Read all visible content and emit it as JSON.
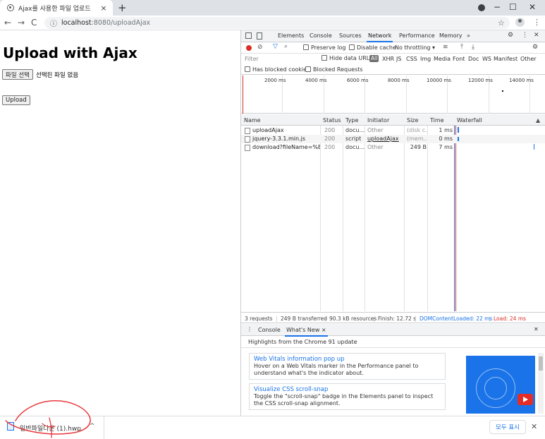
{
  "browser": {
    "tab_title": "Ajax를 사용한 파일 업로드",
    "url_host": "localhost",
    "url_rest": ":8080/uploadAjax"
  },
  "page": {
    "heading": "Upload with Ajax",
    "file_button": "파일 선택",
    "file_status": "선택된 파일 없음",
    "upload_button": "Upload"
  },
  "devtools": {
    "tabs": [
      "Elements",
      "Console",
      "Sources",
      "Network",
      "Performance",
      "Memory"
    ],
    "more_tabs": "»",
    "toolbar": {
      "preserve_log": "Preserve log",
      "disable_cache": "Disable cache",
      "throttling": "No throttling ▾"
    },
    "filter_placeholder": "Filter",
    "hide_data_urls": "Hide data URLs",
    "types": [
      "All",
      "XHR",
      "JS",
      "CSS",
      "Img",
      "Media",
      "Font",
      "Doc",
      "WS",
      "Manifest",
      "Other"
    ],
    "blocked_cookies": "Has blocked cookies",
    "blocked_requests": "Blocked Requests",
    "ticks": [
      "2000 ms",
      "4000 ms",
      "6000 ms",
      "8000 ms",
      "10000 ms",
      "12000 ms",
      "14000 ms"
    ],
    "columns": [
      "Name",
      "Status",
      "Type",
      "Initiator",
      "Size",
      "Time",
      "Waterfall"
    ],
    "requests": [
      {
        "name": "uploadAjax",
        "status": "200",
        "type": "docu...",
        "initiator": "Other",
        "size": "(disk c...",
        "time": "1 ms"
      },
      {
        "name": "jquery-3.3.1.min.js",
        "status": "200",
        "type": "script",
        "initiator": "uploadAjax",
        "size": "(mem...",
        "time": "0 ms"
      },
      {
        "name": "download?fileName=%EC...",
        "status": "200",
        "type": "docu...",
        "initiator": "Other",
        "size": "249 B",
        "time": "7 ms"
      }
    ],
    "summary": {
      "requests": "3 requests",
      "transferred": "249 B transferred",
      "resources": "90.3 kB resources",
      "finish": "Finish: 12.72 s",
      "dom": "DOMContentLoaded: 22 ms",
      "load": "Load: 24 ms"
    },
    "drawer": {
      "console": "Console",
      "whatsnew": "What's New ×",
      "highlights": "Highlights from the Chrome 91 update",
      "items": [
        {
          "title": "Web Vitals information pop up",
          "desc": "Hover on a Web Vitals marker in the Performance panel to understand what's the indicator about."
        },
        {
          "title": "Visualize CSS scroll-snap",
          "desc": "Toggle the \"scroll-snap\" badge in the Elements panel to inspect the CSS scroll-snap alignment."
        }
      ]
    }
  },
  "download": {
    "filename": "일반파일다운 (1).hwp",
    "show_all": "모두 표시"
  },
  "colors": {
    "accent": "#1a73e8",
    "record": "#d93025",
    "annotation": "#e8383d"
  }
}
